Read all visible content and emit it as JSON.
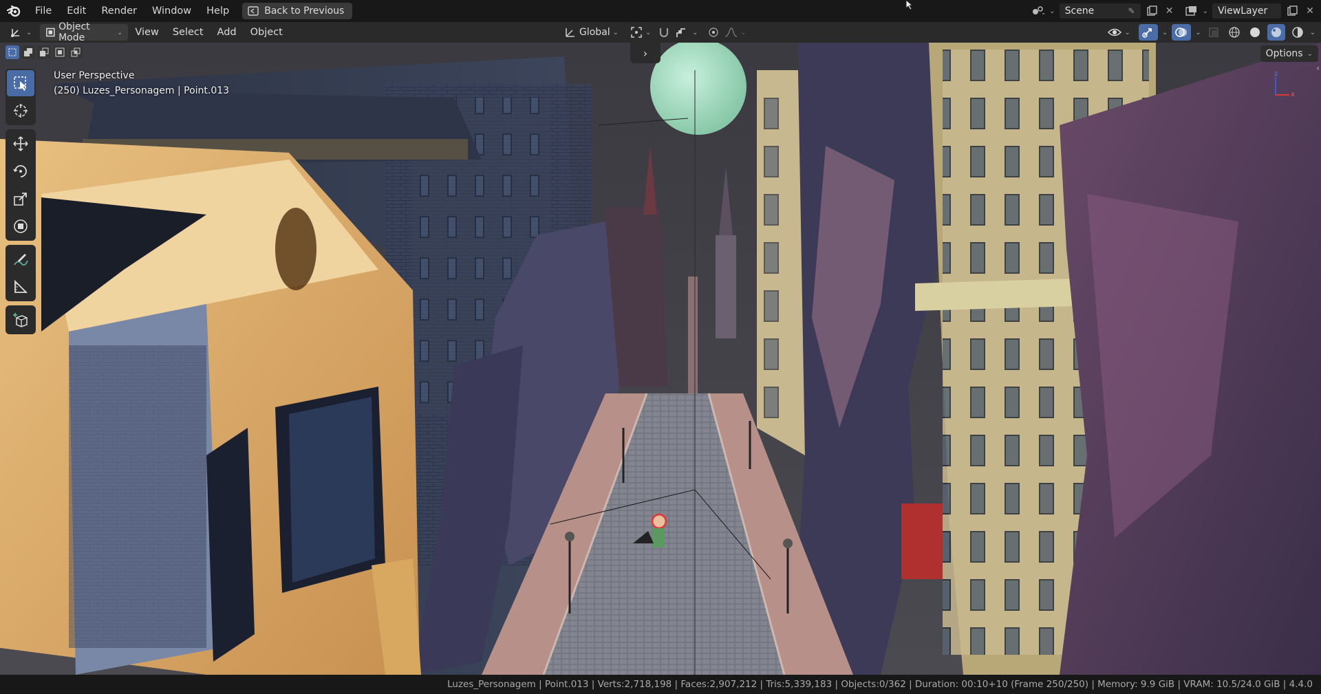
{
  "menu": {
    "items": [
      "File",
      "Edit",
      "Render",
      "Window",
      "Help"
    ],
    "back_button": "Back to Previous"
  },
  "top_right": {
    "scene_label": "Scene",
    "view_layer_label": "ViewLayer"
  },
  "viewport_header": {
    "mode": "Object Mode",
    "menus": [
      "View",
      "Select",
      "Add",
      "Object"
    ],
    "transform_orientation": "Global",
    "options_label": "Options"
  },
  "viewport": {
    "perspective_label": "User Perspective",
    "active_object_label": "(250) Luzes_Personagem | Point.013",
    "gizmo_axes": [
      "z",
      "x"
    ]
  },
  "toolbar": {
    "tools": [
      "select-box",
      "cursor",
      "move",
      "rotate",
      "scale",
      "transform",
      "annotate",
      "measure",
      "add-cube"
    ],
    "active_tool": "select-box"
  },
  "statusbar": {
    "text": "Luzes_Personagem | Point.013 | Verts:2,718,198 | Faces:2,907,212 | Tris:5,339,183 | Objects:0/362 | Duration: 00:10+10 (Frame 250/250) | Memory: 9.9 GiB | VRAM: 10.5/24.0 GiB | 4.4.0"
  },
  "colors": {
    "topbar_bg": "#181818",
    "header_bg": "#2a2a2a",
    "accent": "#4a6ca6",
    "status_text": "#a9a9a9"
  }
}
